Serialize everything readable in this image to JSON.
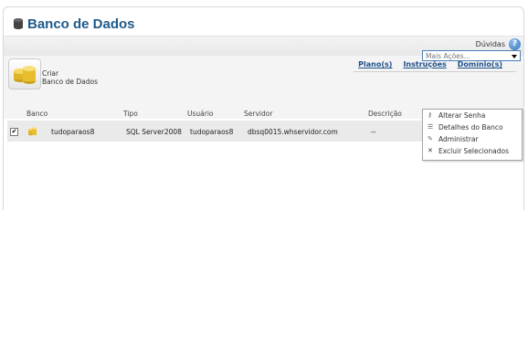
{
  "header": {
    "title": "Banco de Dados"
  },
  "help": {
    "label": "Dúvidas",
    "icon": "help-icon"
  },
  "create": {
    "line1": "Criar",
    "line2": "Banco de Dados"
  },
  "links": [
    "Plano(s)",
    "Instruções",
    "Domínio(s)"
  ],
  "actions": {
    "placeholder": "Mais Ações..."
  },
  "table": {
    "columns": [
      "Banco",
      "Tipo",
      "Usuário",
      "Servidor",
      "Descrição"
    ],
    "rows": [
      {
        "checked": true,
        "banco": "tudoparaos8",
        "tipo": "SQL Server2008",
        "usuario": "tudoparaos8",
        "servidor": "dbsq0015.whservidor.com",
        "descricao": "--"
      }
    ]
  },
  "menu": {
    "items": [
      {
        "label": "Alterar Senha",
        "icon": "key-icon"
      },
      {
        "label": "Detalhes do Banco",
        "icon": "list-icon"
      },
      {
        "label": "Administrar",
        "icon": "wrench-icon"
      },
      {
        "label": "Excluir Selecionados",
        "icon": "delete-icon"
      }
    ]
  },
  "colors": {
    "title": "#1f5a8a",
    "link": "#1f4f8a",
    "select_border": "#4a7eb8"
  }
}
